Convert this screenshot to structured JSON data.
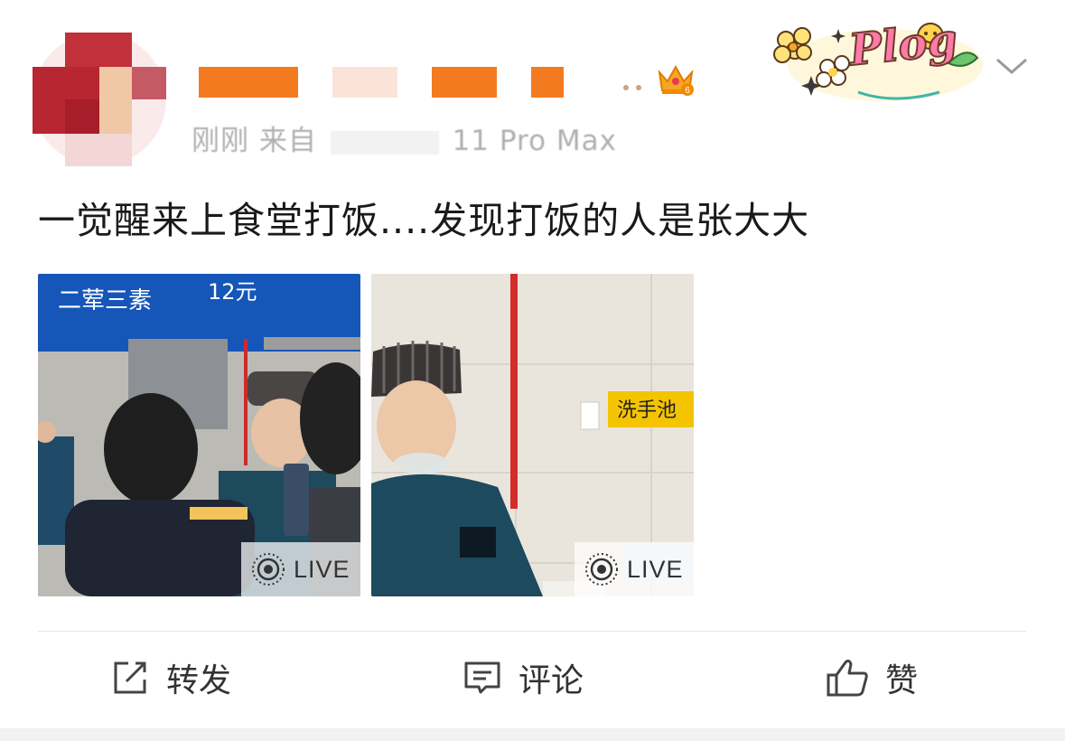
{
  "header": {
    "meta_prefix": "刚刚 来自",
    "meta_device": "11 Pro Max",
    "badge_text": "Plog",
    "crown_level": "6",
    "crown_icon": "crown-icon",
    "menu_icon": "chevron-down-icon",
    "redaction_color": "#f47a20"
  },
  "post": {
    "text": "一觉醒来上食堂打饭....发现打饭的人是张大大"
  },
  "photos": [
    {
      "sign_text": "二荤三素",
      "sign_price": "12元",
      "live_label": "LIVE"
    },
    {
      "sign_text": "洗手池",
      "live_label": "LIVE"
    }
  ],
  "actions": {
    "repost": {
      "label": "转发",
      "icon": "share-icon"
    },
    "comment": {
      "label": "评论",
      "icon": "comment-icon"
    },
    "like": {
      "label": "赞",
      "icon": "thumbs-up-icon"
    }
  }
}
